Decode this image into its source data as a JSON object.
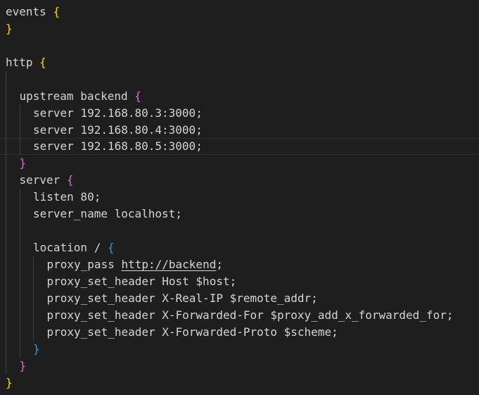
{
  "editor": {
    "theme": "dark",
    "background": "#1e1e1e",
    "text_color": "#d4d4d4",
    "bracket_colors": [
      "#ffd700",
      "#da70d6",
      "#179fff"
    ],
    "lines": [
      {
        "t1": "events ",
        "b": "{"
      },
      {
        "b": "}"
      },
      {},
      {
        "t1": "http ",
        "b": "{"
      },
      {},
      {
        "t1": "upstream backend ",
        "b": "{"
      },
      {
        "t1": "server 192.168.80.3:3000;"
      },
      {
        "t1": "server 192.168.80.4:3000;"
      },
      {
        "t1": "server 192.168.80.5:3000;"
      },
      {
        "b": "}"
      },
      {
        "t1": "server ",
        "b": "{"
      },
      {
        "t1": "listen 80;"
      },
      {
        "t1": "server_name localhost;"
      },
      {},
      {
        "t1": "location / ",
        "b": "{"
      },
      {
        "t1": "proxy_pass ",
        "url": "http://backend",
        "t2": ";"
      },
      {
        "t1": "proxy_set_header Host $host;"
      },
      {
        "t1": "proxy_set_header X-Real-IP $remote_addr;"
      },
      {
        "t1": "proxy_set_header X-Forwarded-For $proxy_add_x_forwarded_for;"
      },
      {
        "t1": "proxy_set_header X-Forwarded-Proto $scheme;"
      },
      {
        "b": "}"
      },
      {
        "b": "}"
      },
      {
        "b": "}"
      }
    ]
  }
}
